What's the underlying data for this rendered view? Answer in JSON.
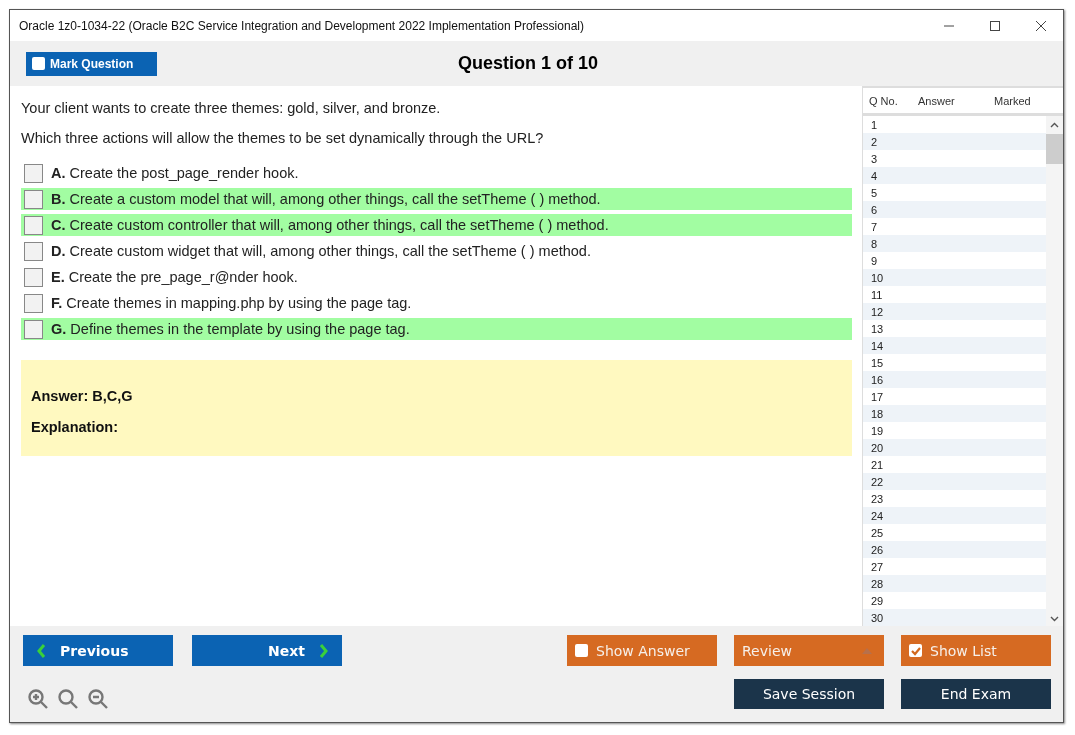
{
  "window": {
    "title": "Oracle 1z0-1034-22 (Oracle B2C Service Integration and Development 2022 Implementation Professional)"
  },
  "toolbar": {
    "mark_question": {
      "label": "Mark Question",
      "checked": false
    },
    "heading": "Question 1 of 10"
  },
  "question": {
    "paragraphs": [
      "Your client wants to create three themes: gold, silver, and bronze.",
      "Which three actions will allow the themes to be set dynamically through the URL?"
    ],
    "options": [
      {
        "letter": "A.",
        "text": "Create the post_page_render hook.",
        "checked": false,
        "highlighted": false
      },
      {
        "letter": "B.",
        "text": "Create a custom model that will, among other things, call the setTheme ( ) method.",
        "checked": false,
        "highlighted": true
      },
      {
        "letter": "C.",
        "text": "Create custom controller that will, among other things, call the setTheme ( ) method.",
        "checked": false,
        "highlighted": true
      },
      {
        "letter": "D.",
        "text": "Create custom widget that will, among other things, call the setTheme ( ) method.",
        "checked": false,
        "highlighted": false
      },
      {
        "letter": "E.",
        "text": "Create the pre_page_r@nder hook.",
        "checked": false,
        "highlighted": false
      },
      {
        "letter": "F.",
        "text": "Create themes in mapping.php by using the page tag.",
        "checked": false,
        "highlighted": false
      },
      {
        "letter": "G.",
        "text": "Define themes in the template by using the page tag.",
        "checked": false,
        "highlighted": true
      }
    ]
  },
  "answer_panel": {
    "answer": "Answer: B,C,G",
    "explanation": "Explanation:"
  },
  "question_list": {
    "columns": [
      "Q No.",
      "Answer",
      "Marked"
    ],
    "rows": [
      "1",
      "2",
      "3",
      "4",
      "5",
      "6",
      "7",
      "8",
      "9",
      "10",
      "11",
      "12",
      "13",
      "14",
      "15",
      "16",
      "17",
      "18",
      "19",
      "20",
      "21",
      "22",
      "23",
      "24",
      "25",
      "26",
      "27",
      "28",
      "29",
      "30"
    ]
  },
  "navigation": {
    "previous": "Previous",
    "next": "Next"
  },
  "actions": [
    {
      "kind": "toggle",
      "label": "Show Answer",
      "checked": false
    },
    {
      "kind": "dropdown",
      "label": "Review"
    },
    {
      "kind": "toggle",
      "label": "Show List",
      "checked": true
    }
  ],
  "session_buttons": [
    "Save Session",
    "End Exam"
  ]
}
